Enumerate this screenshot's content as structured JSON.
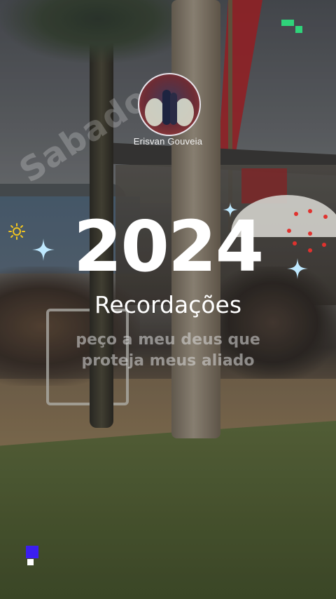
{
  "watermark": {
    "text": "Sabadoo"
  },
  "profile": {
    "name": "Erisvan Gouveia"
  },
  "overlay": {
    "year": "2024",
    "subtitle": "Recordações",
    "caption": "peço a meu deus que proteja meus aliado"
  },
  "colors": {
    "title": "#ffffff",
    "sparkle": "#bfe9ff",
    "pixel_green": "#2fd47a",
    "pixel_blue": "#3b1ef0",
    "sun": "#f0c420"
  },
  "icons": [
    "sparkle-icon",
    "sun-icon",
    "pixel-logo-icon",
    "avatar-image"
  ]
}
